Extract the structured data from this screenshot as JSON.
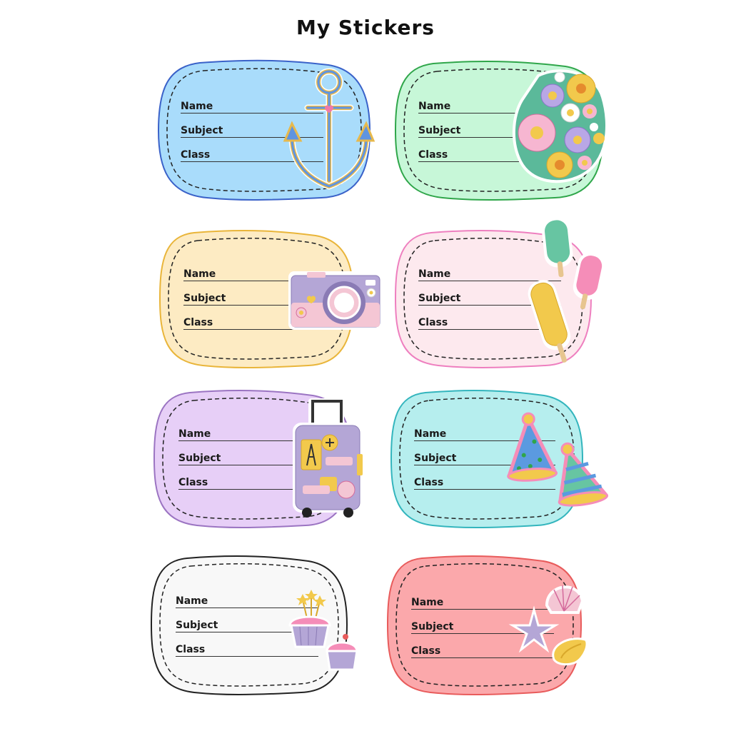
{
  "page": {
    "title": "My Stickers"
  },
  "field_labels": {
    "name": "Name",
    "subject": "Subject",
    "class": "Class"
  },
  "labels": [
    {
      "id": "blue",
      "fill": "#a9dcfb",
      "stroke": "#3a62c9",
      "sticker": "anchor-icon"
    },
    {
      "id": "green",
      "fill": "#c7f7d8",
      "stroke": "#2fa64a",
      "sticker": "flowers-icon"
    },
    {
      "id": "yellow",
      "fill": "#fdebc3",
      "stroke": "#e9b53a",
      "sticker": "camera-icon"
    },
    {
      "id": "pink",
      "fill": "#fde9ee",
      "stroke": "#ee7fbf",
      "sticker": "popsicle-icon"
    },
    {
      "id": "purple",
      "fill": "#e7cff7",
      "stroke": "#9b74c2",
      "sticker": "suitcase-icon"
    },
    {
      "id": "teal",
      "fill": "#b6eeee",
      "stroke": "#33b5bd",
      "sticker": "party-hat-icon"
    },
    {
      "id": "white",
      "fill": "#f8f8f8",
      "stroke": "#222222",
      "sticker": "cupcake-icon"
    },
    {
      "id": "red",
      "fill": "#fba8ab",
      "stroke": "#e85b5b",
      "sticker": "seashell-icon"
    }
  ]
}
